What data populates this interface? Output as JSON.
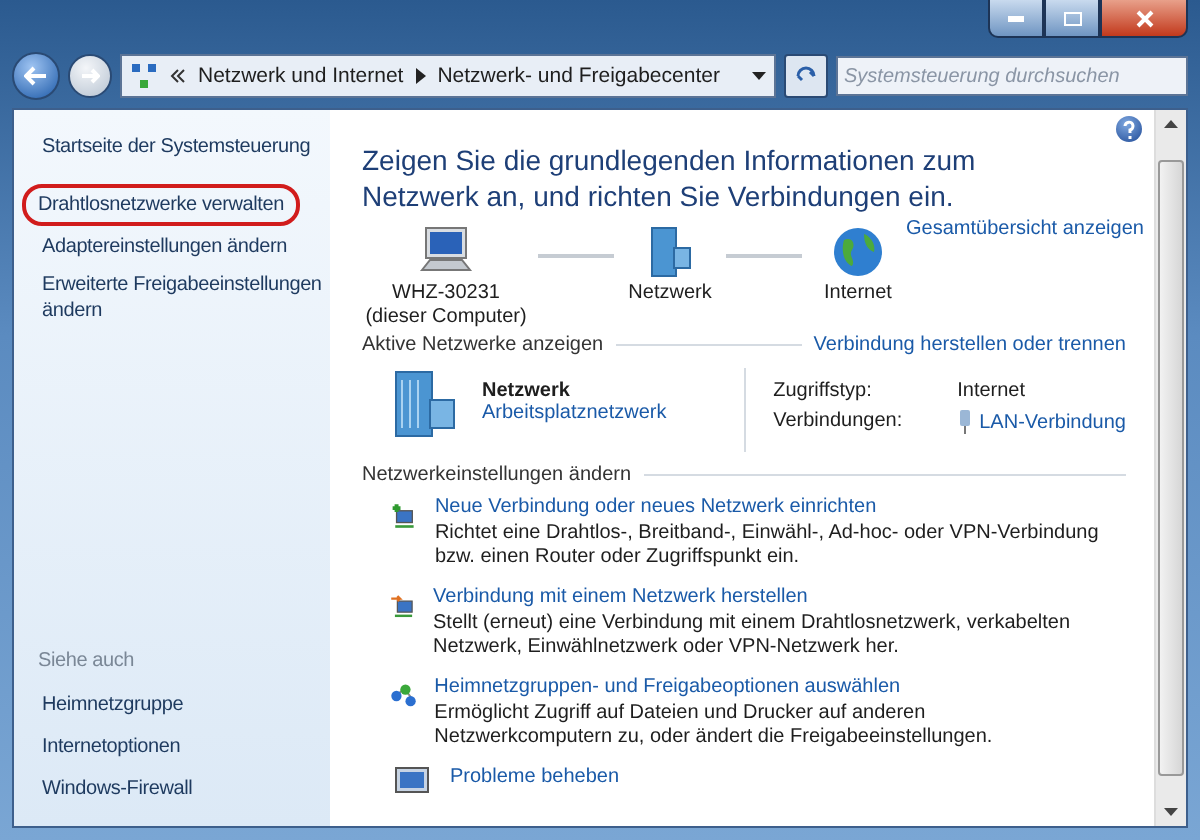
{
  "address_bar": {
    "breadcrumbs": [
      "Netzwerk und Internet",
      "Netzwerk- und Freigabecenter"
    ]
  },
  "search": {
    "placeholder": "Systemsteuerung durchsuchen"
  },
  "sidebar": {
    "items": [
      {
        "label": "Startseite der Systemsteuerung",
        "highlighted": false
      },
      {
        "label": "Drahtlosnetzwerke verwalten",
        "highlighted": true
      },
      {
        "label": "Adaptereinstellungen ändern",
        "highlighted": false
      },
      {
        "label": "Erweiterte Freigabeeinstellungen ändern",
        "highlighted": false
      }
    ],
    "see_also": {
      "heading": "Siehe auch",
      "items": [
        "Heimnetzgruppe",
        "Internetoptionen",
        "Windows-Firewall"
      ]
    }
  },
  "main": {
    "heading": "Zeigen Sie die grundlegenden Informationen zum Netzwerk an, und richten Sie Verbindungen ein.",
    "overview_link": "Gesamtübersicht anzeigen",
    "map": [
      {
        "kind": "computer",
        "label": "WHZ-30231",
        "sublabel": "(dieser Computer)"
      },
      {
        "kind": "network",
        "label": "Netzwerk"
      },
      {
        "kind": "globe",
        "label": "Internet"
      }
    ],
    "active_networks": {
      "title": "Aktive Netzwerke anzeigen",
      "link": "Verbindung herstellen oder trennen",
      "network": {
        "name": "Netzwerk",
        "type": "Arbeitsplatznetzwerk"
      },
      "properties": [
        {
          "kind": "text",
          "label": "Zugriffstyp:",
          "value": "Internet"
        },
        {
          "kind": "link",
          "label": "Verbindungen:",
          "value": "LAN-Verbindung"
        }
      ]
    },
    "settings": {
      "title": "Netzwerkeinstellungen ändern",
      "tasks": [
        {
          "kind": "new",
          "title": "Neue Verbindung oder neues Netzwerk einrichten",
          "description": "Richtet eine Drahtlos-, Breitband-, Einwähl-, Ad-hoc- oder VPN-Verbindung bzw. einen Router oder Zugriffspunkt ein."
        },
        {
          "kind": "connect",
          "title": "Verbindung mit einem Netzwerk herstellen",
          "description": "Stellt (erneut) eine Verbindung mit einem Drahtlosnetzwerk, verkabelten Netzwerk, Einwählnetzwerk oder VPN-Netzwerk her."
        },
        {
          "kind": "homegroup",
          "title": "Heimnetzgruppen- und Freigabeoptionen auswählen",
          "description": "Ermöglicht Zugriff auf Dateien und Drucker auf anderen Netzwerkcomputern zu, oder ändert die Freigabeeinstellungen."
        },
        {
          "kind": "troubleshoot",
          "title": "Probleme beheben"
        }
      ]
    }
  }
}
